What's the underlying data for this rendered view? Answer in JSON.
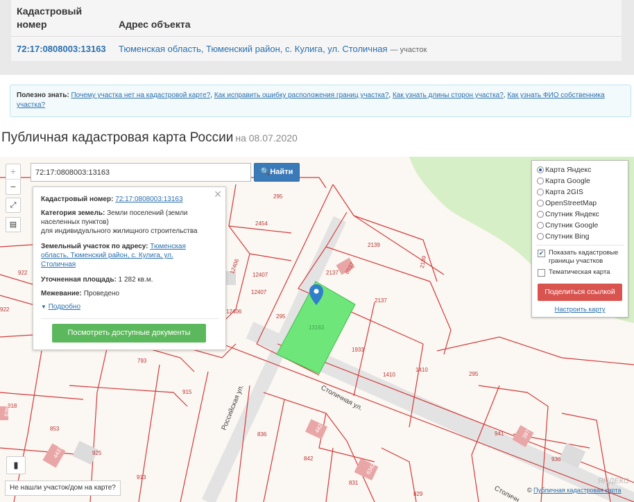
{
  "result_table": {
    "col_number": "Кадастровый номер",
    "col_address": "Адрес объекта",
    "row": {
      "number": "72:17:0808003:13163",
      "address": "Тюменская область, Тюменский район, с. Кулига, ул. Столичная",
      "suffix": "— участок"
    }
  },
  "hint": {
    "prefix": "Полезно знать:",
    "links": [
      "Почему участка нет на кадастровой карте?",
      "Как исправить ошибку расположения границ участка?",
      "Как узнать длины сторон участка?",
      "Как узнать ФИО собственника участка?"
    ]
  },
  "page": {
    "title": "Публичная кадастровая карта России",
    "date": "на 08.07.2020"
  },
  "map": {
    "search_value": "72:17:0808003:13163",
    "search_button": "Найти",
    "zoom_in": "+",
    "zoom_out": "−",
    "popup": {
      "number_label": "Кадастровый номер:",
      "number_value": "72:17:0808003:13163",
      "category_label": "Категория земель:",
      "category_value_1": "Земли поселений (земли",
      "category_value_2": "населенных пунктов)",
      "category_value_3": "для индивидуального жилищного строительства",
      "address_label": "Земельный участок по адресу:",
      "address_value_1": "Тюменская",
      "address_value_2": "область, Тюменский район, с. Кулига, ул.",
      "address_value_3": "Столичная",
      "area_label": "Уточненная площадь:",
      "area_value": "1 282 кв.м.",
      "survey_label": "Межевание:",
      "survey_value": "Проведено",
      "more_link": "Подробно",
      "docs_button": "Посмотреть доступные документы"
    },
    "layers": [
      {
        "label": "Карта Яндекс",
        "selected": true
      },
      {
        "label": "Карта Google",
        "selected": false
      },
      {
        "label": "Карта 2GIS",
        "selected": false
      },
      {
        "label": "OpenStreetMap",
        "selected": false
      },
      {
        "label": "Спутник Яндекс",
        "selected": false
      },
      {
        "label": "Спутник Google",
        "selected": false
      },
      {
        "label": "Спутник Bing",
        "selected": false
      }
    ],
    "show_boundaries": {
      "label_1": "Показать кадастровые",
      "label_2": "границы участков",
      "checked": true
    },
    "thematic": {
      "label": "Тематическая карта",
      "checked": false
    },
    "share_button": "Поделиться ссылкой",
    "configure_link": "Настроить карту",
    "not_found": "Не нашли участок/дом на карте?",
    "attribution_prefix": "©",
    "attribution_link": "Публичная кадастровая карта",
    "yandex_mark": "ЯНДЕКС",
    "streets": {
      "main": "Столичная ул.",
      "side": "Российская ул.",
      "bottom": "Столичн"
    },
    "parcel_numbers": [
      "295",
      "2454",
      "12406",
      "12407",
      "12407",
      "12406",
      "922",
      "922",
      "2139",
      "6537",
      "2137",
      "2139",
      "2137",
      "295",
      "13163",
      "1933",
      "1410",
      "1410",
      "295",
      "793",
      "915",
      "918",
      "853",
      "925",
      "913",
      "836",
      "842",
      "831",
      "6342",
      "4427",
      "941",
      "3976",
      "936",
      "4437",
      "6356",
      "829"
    ],
    "colors": {
      "parcel_fill": "#6ee67a",
      "boundary": "#d23b3b",
      "marker": "#2f7fc9",
      "green_area": "#d7efc7"
    }
  }
}
